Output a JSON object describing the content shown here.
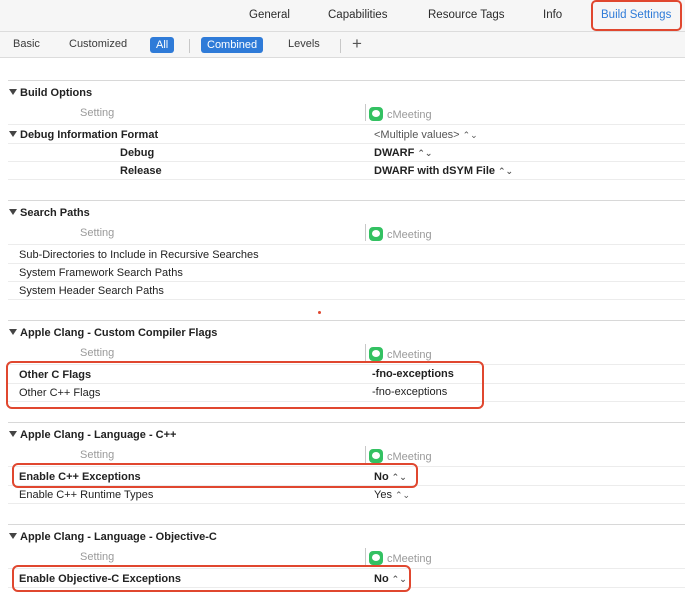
{
  "top_tabs": [
    "General",
    "Capabilities",
    "Resource Tags",
    "Info",
    "Build Settings"
  ],
  "filter": {
    "basic": "Basic",
    "customized": "Customized",
    "all": "All",
    "combined": "Combined",
    "levels": "Levels",
    "add": "+"
  },
  "column_setting": "Setting",
  "target_name": "cMeeting",
  "sections": {
    "build_options": {
      "title": "Build Options",
      "debug_info_format": "Debug Information Format",
      "debug_info_value": "<Multiple values>",
      "debug_label": "Debug",
      "debug_value": "DWARF",
      "release_label": "Release",
      "release_value": "DWARF with dSYM File"
    },
    "search_paths": {
      "title": "Search Paths",
      "rows": [
        "Sub-Directories to Include in Recursive Searches",
        "System Framework Search Paths",
        "System Header Search Paths"
      ]
    },
    "custom_flags": {
      "title": "Apple Clang - Custom Compiler Flags",
      "other_c_flags": "Other C Flags",
      "other_c_value": "-fno-exceptions",
      "other_cpp_flags": "Other C++ Flags",
      "other_cpp_value": "-fno-exceptions"
    },
    "lang_cpp": {
      "title": "Apple Clang - Language - C++",
      "enable_exceptions": "Enable C++ Exceptions",
      "enable_exceptions_value": "No",
      "enable_rtti": "Enable C++ Runtime Types",
      "enable_rtti_value": "Yes"
    },
    "lang_objc": {
      "title": "Apple Clang - Language - Objective-C",
      "enable_exceptions": "Enable Objective-C Exceptions",
      "enable_exceptions_value": "No"
    }
  },
  "colors": {
    "accent": "#2f7bd8",
    "highlight": "#e0472f",
    "app_icon": "#33c162"
  },
  "icons": [
    "disclosure-triangle-icon",
    "app-icon",
    "popup-chevron-icon",
    "plus-icon"
  ]
}
